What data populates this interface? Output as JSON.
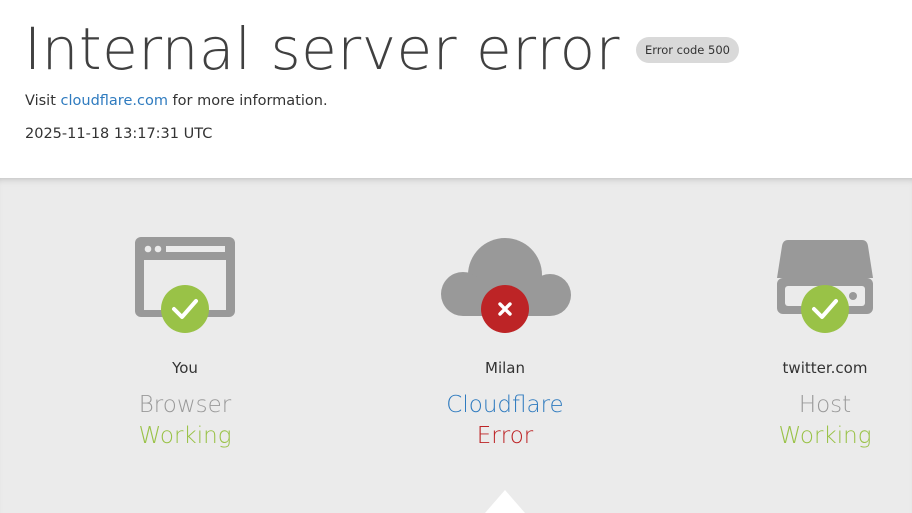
{
  "header": {
    "title": "Internal server error",
    "badge": "Error code 500",
    "info_prefix": "Visit ",
    "info_link": "cloudflare.com",
    "info_suffix": " for more information.",
    "timestamp": "2025-11-18 13:17:31 UTC"
  },
  "colors": {
    "working": "#99c247",
    "error": "#bd2426",
    "link": "#2f7bbf",
    "icon_gray": "#999999"
  },
  "steps": [
    {
      "location": "You",
      "name": "Browser",
      "status": "Working",
      "icon": "browser-icon",
      "status_icon": "check-icon"
    },
    {
      "location": "Milan",
      "name": "Cloudflare",
      "status": "Error",
      "icon": "cloud-icon",
      "status_icon": "x-icon"
    },
    {
      "location": "twitter.com",
      "name": "Host",
      "status": "Working",
      "icon": "server-icon",
      "status_icon": "check-icon"
    }
  ]
}
